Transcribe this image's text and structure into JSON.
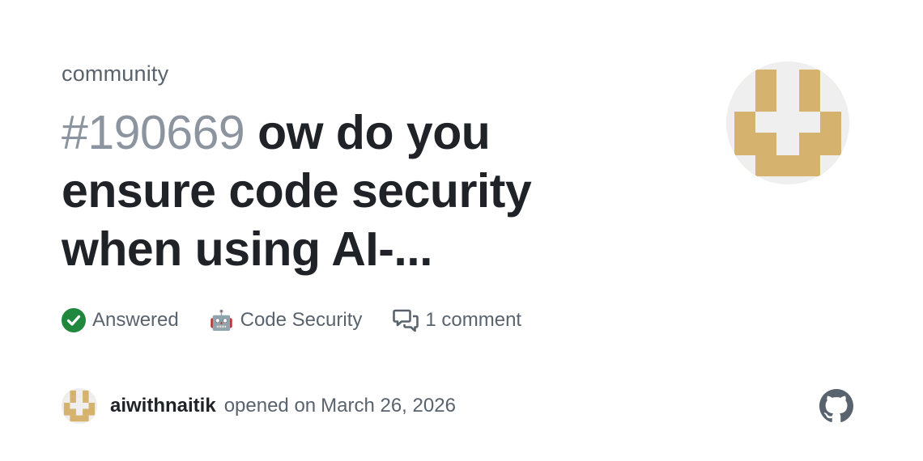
{
  "repo": {
    "name": "community"
  },
  "discussion": {
    "number": "#190669",
    "title": "ow do you ensure code security when using AI-..."
  },
  "meta": {
    "status_label": "Answered",
    "category_emoji": "🤖",
    "category_label": "Code Security",
    "comments_label": "1 comment"
  },
  "author": {
    "username": "aiwithnaitik",
    "opened_text": "opened on",
    "date": "March 26, 2026"
  },
  "icons": {
    "status": "check-circle-icon",
    "comments": "comment-discussion-icon",
    "brand": "github-logo-icon"
  },
  "colors": {
    "answered_green": "#1f883d",
    "avatar_gold": "#d6b26f",
    "muted_text": "#59636e",
    "number_gray": "#8c959f"
  }
}
